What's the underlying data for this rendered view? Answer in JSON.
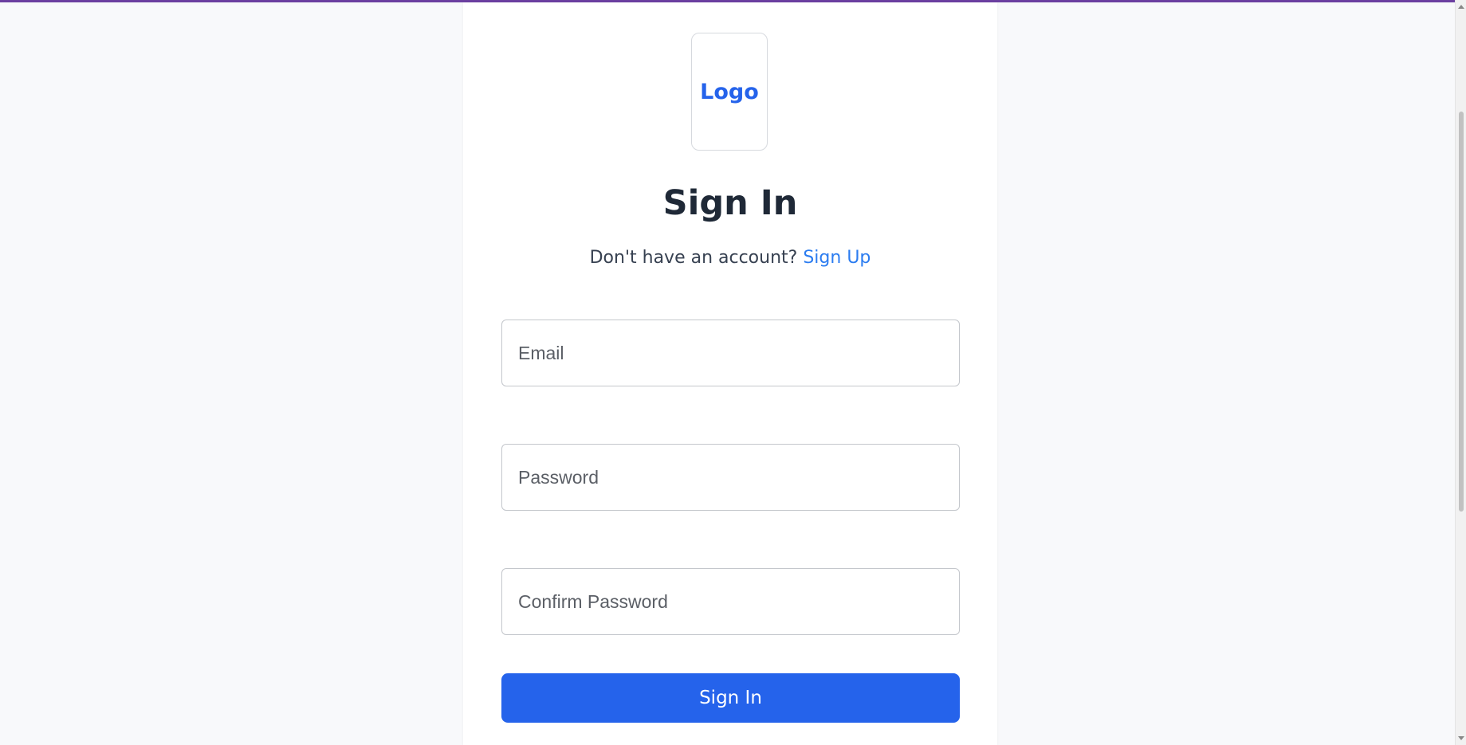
{
  "brand": {
    "logo_text": "Logo",
    "accent_color": "#2563eb",
    "top_bar_color": "#6b3fa0"
  },
  "header": {
    "title": "Sign In",
    "prompt_text": "Don't have an account?",
    "signup_link": "Sign Up"
  },
  "form": {
    "email_placeholder": "Email",
    "password_placeholder": "Password",
    "confirm_password_placeholder": "Confirm Password",
    "submit_label": "Sign In"
  }
}
